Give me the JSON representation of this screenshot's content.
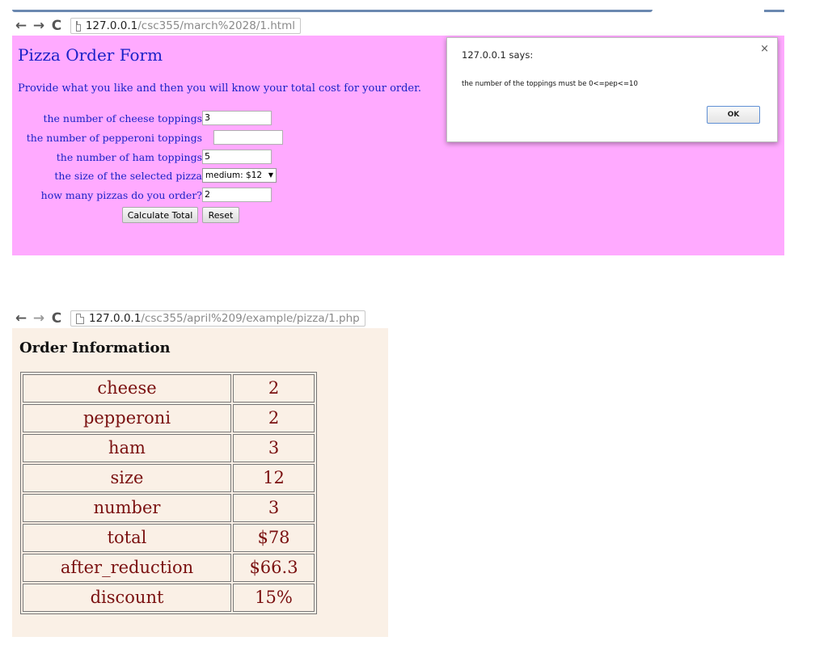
{
  "top_window": {
    "url_host": "127.0.0.1",
    "url_path": "/csc355/march%2028/1.html",
    "page_title": "Pizza Order Form",
    "intro": "Provide what you like and then you will know your total cost for your order.",
    "form": {
      "cheese_label": "the number of cheese toppings",
      "cheese_value": "3",
      "pepperoni_label": "the number of pepperoni toppings",
      "pepperoni_value": "",
      "ham_label": "the number of ham toppings",
      "ham_value": "5",
      "size_label": "the size of the selected pizza",
      "size_selected": "medium: $12",
      "count_label": "how many pizzas do you order?",
      "count_value": "2",
      "calculate_label": "Calculate Total",
      "reset_label": "Reset"
    },
    "background_color": "#ffaaff",
    "text_color": "#1a22c8"
  },
  "alert_dialog": {
    "title": "127.0.0.1 says:",
    "close_glyph": "×",
    "message": "the number of the toppings must be 0<=pep<=10",
    "ok_label": "OK"
  },
  "bottom_window": {
    "url_host": "127.0.0.1",
    "url_path": "/csc355/april%209/example/pizza/1.php",
    "page_title": "Order Information",
    "background_color": "#faf0e6",
    "text_color": "#7a1010",
    "rows": [
      {
        "name": "cheese",
        "value": "2"
      },
      {
        "name": "pepperoni",
        "value": "2"
      },
      {
        "name": "ham",
        "value": "3"
      },
      {
        "name": "size",
        "value": "12"
      },
      {
        "name": "number",
        "value": "3"
      },
      {
        "name": "total",
        "value": "$78"
      },
      {
        "name": "after_reduction",
        "value": "$66.3"
      },
      {
        "name": "discount",
        "value": "15%"
      }
    ]
  },
  "icons": {
    "back": "←",
    "forward": "→",
    "reload": "C"
  }
}
